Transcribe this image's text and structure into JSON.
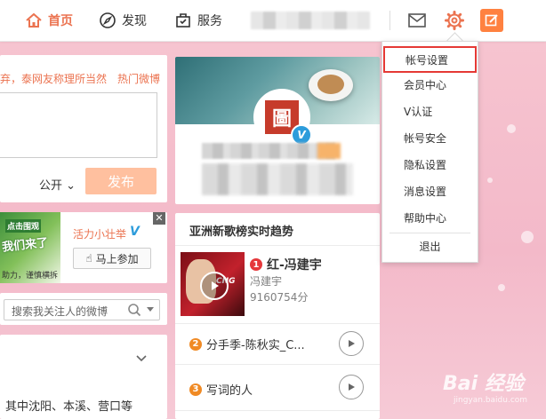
{
  "topbar": {
    "nav": [
      {
        "label": "首页",
        "icon": "home-icon",
        "active": true
      },
      {
        "label": "发现",
        "icon": "compass-icon"
      },
      {
        "label": "服务",
        "icon": "briefcase-icon"
      }
    ],
    "accent_color": "#eb7350"
  },
  "compose": {
    "hint": "弃，泰网友称理所当然",
    "hot_link": "热门微博",
    "visibility": "公开",
    "publish_label": "发布"
  },
  "ad": {
    "image_text_top": "点击围观",
    "image_text_main": "我们来了",
    "image_text_bottom": "助力，谨慎横拆",
    "title": "活力小壮举",
    "badge": "V",
    "join_label": "马上参加",
    "close_glyph": "✕"
  },
  "search": {
    "placeholder": "搜索我关注人的微博"
  },
  "group": {
    "text": "其中沈阳、本溪、营口等"
  },
  "profile": {
    "avatar_glyph": "圖",
    "verify_glyph": "V"
  },
  "chart": {
    "title": "亚洲新歌榜实时趋势",
    "songs": [
      {
        "rank": "1",
        "title": "红-冯建宇",
        "artist": "冯建宇",
        "score": "9160754分",
        "cover_text": "CNG"
      },
      {
        "rank": "2",
        "title": "分手季-陈秋实_C..."
      },
      {
        "rank": "3",
        "title": "写词的人"
      }
    ]
  },
  "settings_menu": {
    "items": [
      {
        "label": "帐号设置",
        "highlighted": true
      },
      {
        "label": "会员中心"
      },
      {
        "label": "V认证"
      },
      {
        "label": "帐号安全"
      },
      {
        "label": "隐私设置"
      },
      {
        "label": "消息设置"
      },
      {
        "label": "帮助中心"
      }
    ],
    "logout_label": "退出",
    "highlight_color": "#e53935"
  },
  "watermark": {
    "text": "Bai 经验",
    "sub": "jingyan.baidu.com"
  }
}
